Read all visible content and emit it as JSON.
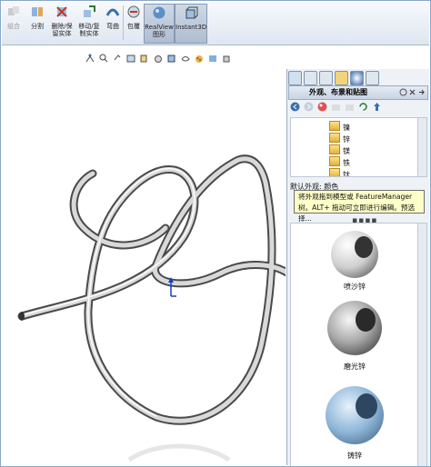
{
  "toolbar": {
    "buttons": [
      {
        "label": "组合",
        "state": "disabled"
      },
      {
        "label": "分割",
        "state": "normal"
      },
      {
        "label": "删除/保\n留实体",
        "state": "normal"
      },
      {
        "label": "移动/复\n制实体",
        "state": "normal"
      },
      {
        "label": "弯曲",
        "state": "normal"
      },
      {
        "label": "包覆",
        "state": "normal"
      },
      {
        "label": "RealView\n图形",
        "state": "active"
      },
      {
        "label": "Instant3D",
        "state": "active"
      }
    ]
  },
  "task_pane": {
    "title": "外观、布景和贴图",
    "tree_items": [
      "镍",
      "锌",
      "镁",
      "铁",
      "钛"
    ],
    "default_appearance_label": "默认外观: 颜色",
    "tooltip": "将外观拖到模型或 FeatureManager 树。ALT+ 拖动可立即进行编辑。预选择...",
    "swatches": [
      {
        "label": "喷沙锌",
        "color": "#d4d4d4"
      },
      {
        "label": "磨光锌",
        "color": "#bfbfbf"
      },
      {
        "label": "铸锌",
        "color": "#8fb6d8"
      }
    ]
  },
  "colors": {
    "accent": "#3a6fb0",
    "tooltip_bg": "#ffffc8",
    "pane_bg": "#eef2f7"
  }
}
